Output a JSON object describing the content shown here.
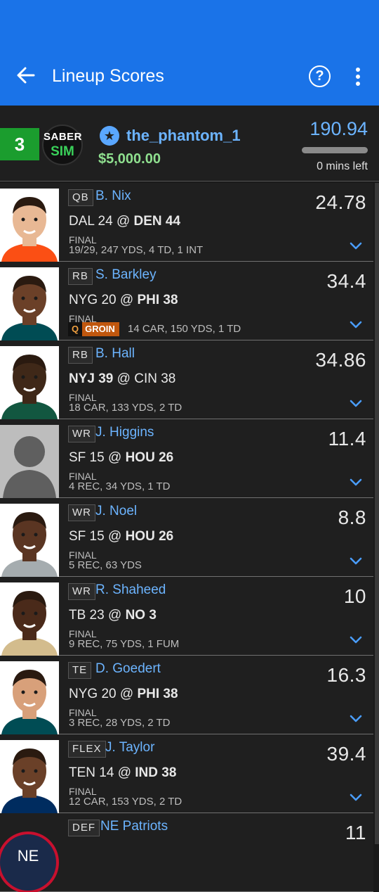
{
  "header": {
    "title": "Lineup Scores",
    "help": "?"
  },
  "summary": {
    "rank": "3",
    "logo_line1": "SABER",
    "logo_line2": "SIM",
    "username": "the_phantom_1",
    "prize": "$5,000.00",
    "total_points": "190.94",
    "time_left": "0 mins left",
    "progress_fraction": 1.0
  },
  "players": [
    {
      "pos": "QB",
      "name": "B. Nix",
      "points": "24.78",
      "away": "DAL 24",
      "home": "DEN 44",
      "winner": "home",
      "status": "FINAL",
      "stats": "19/29, 247 YDS, 4 TD, 1 INT"
    },
    {
      "pos": "RB",
      "name": "S. Barkley",
      "points": "34.4",
      "away": "NYG 20",
      "home": "PHI 38",
      "winner": "home",
      "status": "FINAL",
      "injury": "Q",
      "injury_label": "GROIN",
      "stats": "14 CAR, 150 YDS, 1 TD"
    },
    {
      "pos": "RB",
      "name": "B. Hall",
      "points": "34.86",
      "away": "NYJ 39",
      "home": "CIN 38",
      "winner": "away",
      "status": "FINAL",
      "stats": "18 CAR, 133 YDS, 2 TD"
    },
    {
      "pos": "WR",
      "name": "J. Higgins",
      "points": "11.4",
      "away": "SF 15",
      "home": "HOU 26",
      "winner": "home",
      "status": "FINAL",
      "stats": "4 REC, 34 YDS, 1 TD"
    },
    {
      "pos": "WR",
      "name": "J. Noel",
      "points": "8.8",
      "away": "SF 15",
      "home": "HOU 26",
      "winner": "home",
      "status": "FINAL",
      "stats": "5 REC, 63 YDS"
    },
    {
      "pos": "WR",
      "name": "R. Shaheed",
      "points": "10",
      "away": "TB 23",
      "home": "NO 3",
      "winner": "home",
      "status": "FINAL",
      "stats": "9 REC, 75 YDS, 1 FUM"
    },
    {
      "pos": "TE",
      "name": "D. Goedert",
      "points": "16.3",
      "away": "NYG 20",
      "home": "PHI 38",
      "winner": "home",
      "status": "FINAL",
      "stats": "3 REC, 28 YDS, 2 TD"
    },
    {
      "pos": "FLEX",
      "name": "J. Taylor",
      "points": "39.4",
      "away": "TEN 14",
      "home": "IND 38",
      "winner": "home",
      "status": "FINAL",
      "stats": "12 CAR, 153 YDS, 2 TD"
    },
    {
      "pos": "DEF",
      "name": "NE Patriots",
      "points": "11"
    }
  ],
  "colors": {
    "appbar": "#1a73e8",
    "link": "#6cb4ff",
    "rank_bg": "#1b9d2e",
    "prize": "#8fe08f",
    "injury": "#c0570e"
  }
}
